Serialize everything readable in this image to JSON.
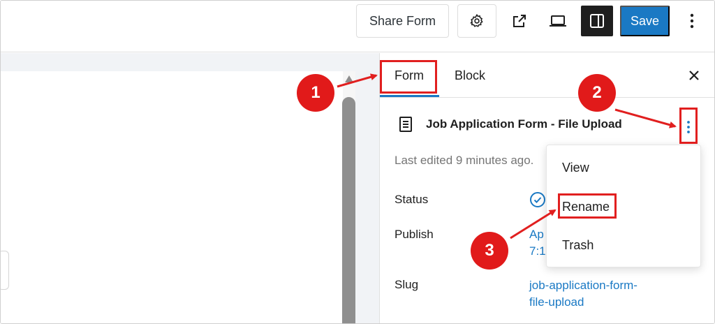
{
  "toolbar": {
    "share_label": "Share Form",
    "save_label": "Save",
    "icons": [
      "gear-icon",
      "external-link-icon",
      "laptop-preview-icon",
      "sidebar-toggle-icon",
      "more-vertical-icon"
    ]
  },
  "sidebar": {
    "tabs": [
      {
        "label": "Form",
        "active": true
      },
      {
        "label": "Block",
        "active": false
      }
    ],
    "post": {
      "title": "Job Application Form - File Upload",
      "last_edited": "Last edited 9 minutes ago."
    },
    "rows": {
      "status": {
        "label": "Status"
      },
      "publish": {
        "label": "Publish",
        "value_line1": "Ap",
        "value_line2": "7:1"
      },
      "slug": {
        "label": "Slug",
        "value_line1": "job-application-form-",
        "value_line2": "file-upload"
      }
    }
  },
  "dropdown": {
    "items": [
      "View",
      "Rename",
      "Trash"
    ]
  },
  "annotations": {
    "badges": [
      "1",
      "2",
      "3"
    ]
  },
  "colors": {
    "accent": "#1a79c4",
    "annotation": "#e11f1f",
    "toolbar_active": "#1e1e1e"
  }
}
